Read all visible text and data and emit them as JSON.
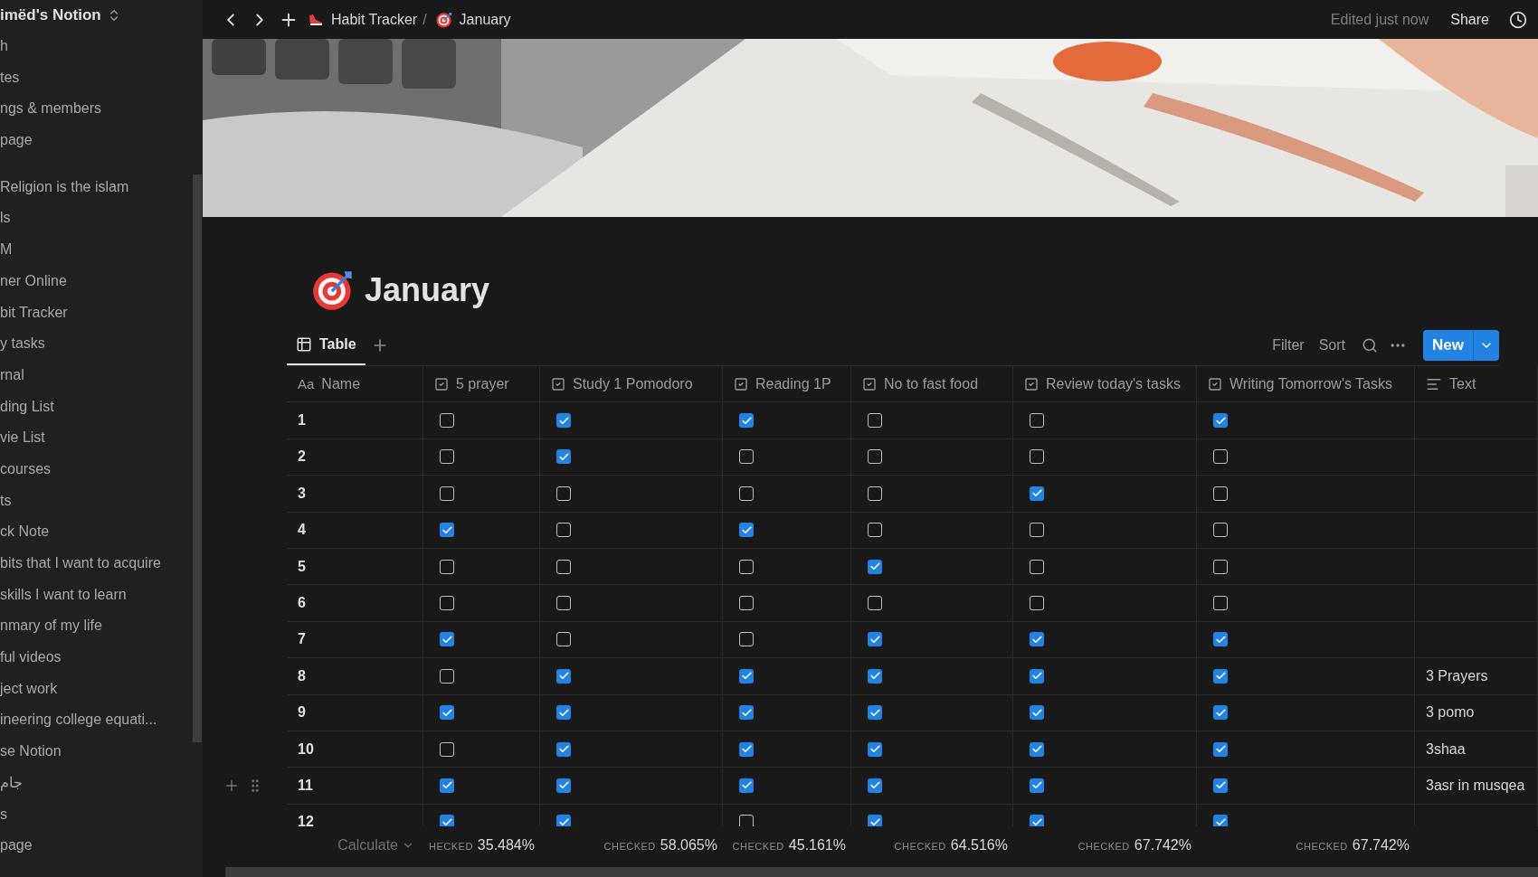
{
  "sidebar": {
    "workspace": "imëd's Notion",
    "top_items": [
      "h",
      "tes",
      "ngs & members",
      "page"
    ],
    "pages": [
      "Religion is the islam",
      "ls",
      "M",
      "ner Online",
      "bit Tracker",
      "y tasks",
      "rnal",
      "ding List",
      "vie List",
      "courses",
      "ts",
      "ck Note",
      "bits that I want to acquire",
      "skills I want to learn",
      "nmary of my life",
      "ful videos",
      "ject work",
      "ineering college equati...",
      "se Notion",
      "جام",
      "s",
      "page"
    ]
  },
  "topbar": {
    "breadcrumbs": [
      {
        "label": "Habit Tracker"
      },
      {
        "label": "January"
      }
    ],
    "separator": "/",
    "edited": "Edited just now",
    "share": "Share"
  },
  "page": {
    "title": "January"
  },
  "views": {
    "tabs": [
      {
        "label": "Table",
        "selected": true
      }
    ],
    "actions": [
      "Filter",
      "Sort"
    ],
    "new_button": "New"
  },
  "table": {
    "columns": [
      {
        "label": "Name",
        "kind": "title",
        "icon_text": "Aa"
      },
      {
        "label": "5 prayer",
        "kind": "checkbox"
      },
      {
        "label": "Study 1 Pomodoro",
        "kind": "checkbox"
      },
      {
        "label": "Reading 1P",
        "kind": "checkbox"
      },
      {
        "label": "No to fast food",
        "kind": "checkbox"
      },
      {
        "label": "Review today's tasks",
        "kind": "checkbox"
      },
      {
        "label": "Writing Tomorrow's Tasks",
        "kind": "checkbox"
      },
      {
        "label": "Text",
        "kind": "text"
      }
    ],
    "rows": [
      {
        "name": "1",
        "checks": [
          false,
          true,
          true,
          false,
          false,
          true
        ]
      },
      {
        "name": "2",
        "checks": [
          false,
          true,
          false,
          false,
          false,
          false
        ]
      },
      {
        "name": "3",
        "checks": [
          false,
          false,
          false,
          false,
          true,
          false
        ]
      },
      {
        "name": "4",
        "checks": [
          true,
          false,
          true,
          false,
          false,
          false
        ]
      },
      {
        "name": "5",
        "checks": [
          false,
          false,
          false,
          true,
          false,
          false
        ]
      },
      {
        "name": "6",
        "checks": [
          false,
          false,
          false,
          false,
          false,
          false
        ]
      },
      {
        "name": "7",
        "checks": [
          true,
          false,
          false,
          true,
          true,
          true
        ]
      },
      {
        "name": "8",
        "checks": [
          false,
          true,
          true,
          true,
          true,
          true
        ],
        "text": "3 Prayers"
      },
      {
        "name": "9",
        "checks": [
          true,
          true,
          true,
          true,
          true,
          true
        ],
        "text": "3 pomo"
      },
      {
        "name": "10",
        "checks": [
          false,
          true,
          true,
          true,
          true,
          true
        ],
        "text": "3shaa"
      },
      {
        "name": "11",
        "checks": [
          true,
          true,
          true,
          true,
          true,
          true
        ],
        "text": "3asr in musqea",
        "hovered": true
      },
      {
        "name": "12",
        "checks": [
          true,
          true,
          false,
          true,
          true,
          true
        ]
      }
    ],
    "footer": {
      "calculate": "Calculate",
      "calcs": [
        {
          "label": "HECKED",
          "value": "35.484%"
        },
        {
          "label": "CHECKED",
          "value": "58.065%"
        },
        {
          "label": "CHECKED",
          "value": "45.161%"
        },
        {
          "label": "CHECKED",
          "value": "64.516%"
        },
        {
          "label": "CHECKED",
          "value": "67.742%"
        },
        {
          "label": "CHECKED",
          "value": "67.742%"
        }
      ]
    }
  }
}
